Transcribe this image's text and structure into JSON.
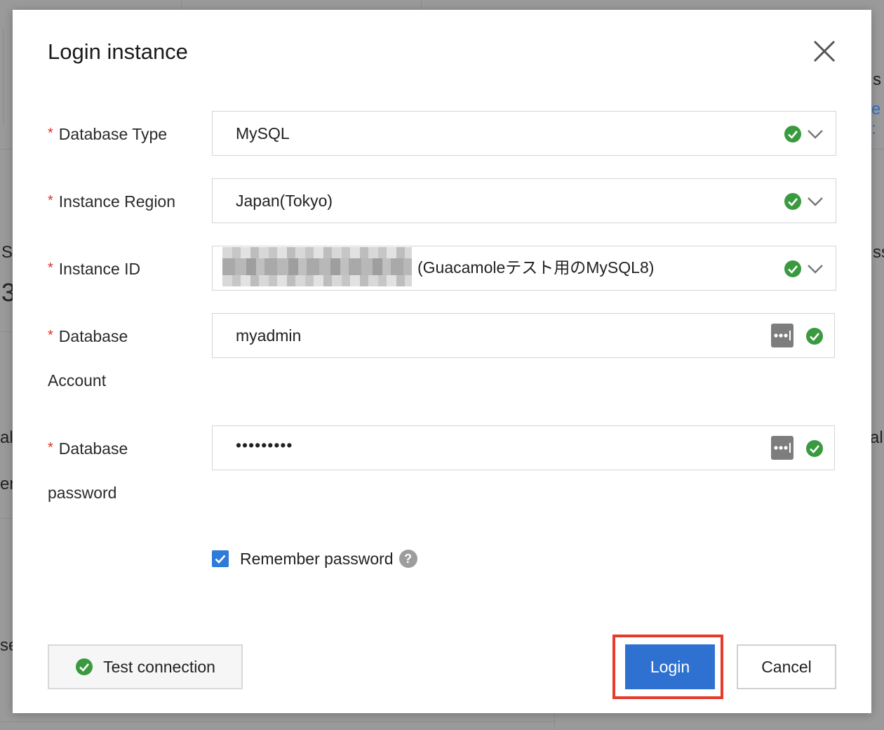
{
  "dialog": {
    "title": "Login instance",
    "close_icon": "close-icon"
  },
  "fields": {
    "database_type": {
      "label": "Database Type",
      "required": "*",
      "value": "MySQL"
    },
    "instance_region": {
      "label": "Instance Region",
      "required": "*",
      "value": "Japan(Tokyo)"
    },
    "instance_id": {
      "label": "Instance ID",
      "required": "*",
      "value_suffix": "(Guacamoleテスト用のMySQL8)",
      "value_redacted": true
    },
    "database_account": {
      "label_line1": "Database",
      "label_line2": "Account",
      "required": "*",
      "value": "myadmin"
    },
    "database_password": {
      "label_line1": "Database",
      "label_line2": "password",
      "required": "*",
      "value": "•••••••••"
    }
  },
  "remember": {
    "label": "Remember password",
    "checked": true,
    "help": "?"
  },
  "buttons": {
    "test_connection": "Test connection",
    "login": "Login",
    "cancel": "Cancel"
  },
  "background_fragments": [
    "s",
    "e :",
    "S",
    "3",
    "ss",
    "al/",
    "al",
    "er",
    "se"
  ],
  "colors": {
    "accent": "#2f71d1",
    "success": "#3a9a3f",
    "required": "#e0302a",
    "highlight": "#e63a2c"
  }
}
